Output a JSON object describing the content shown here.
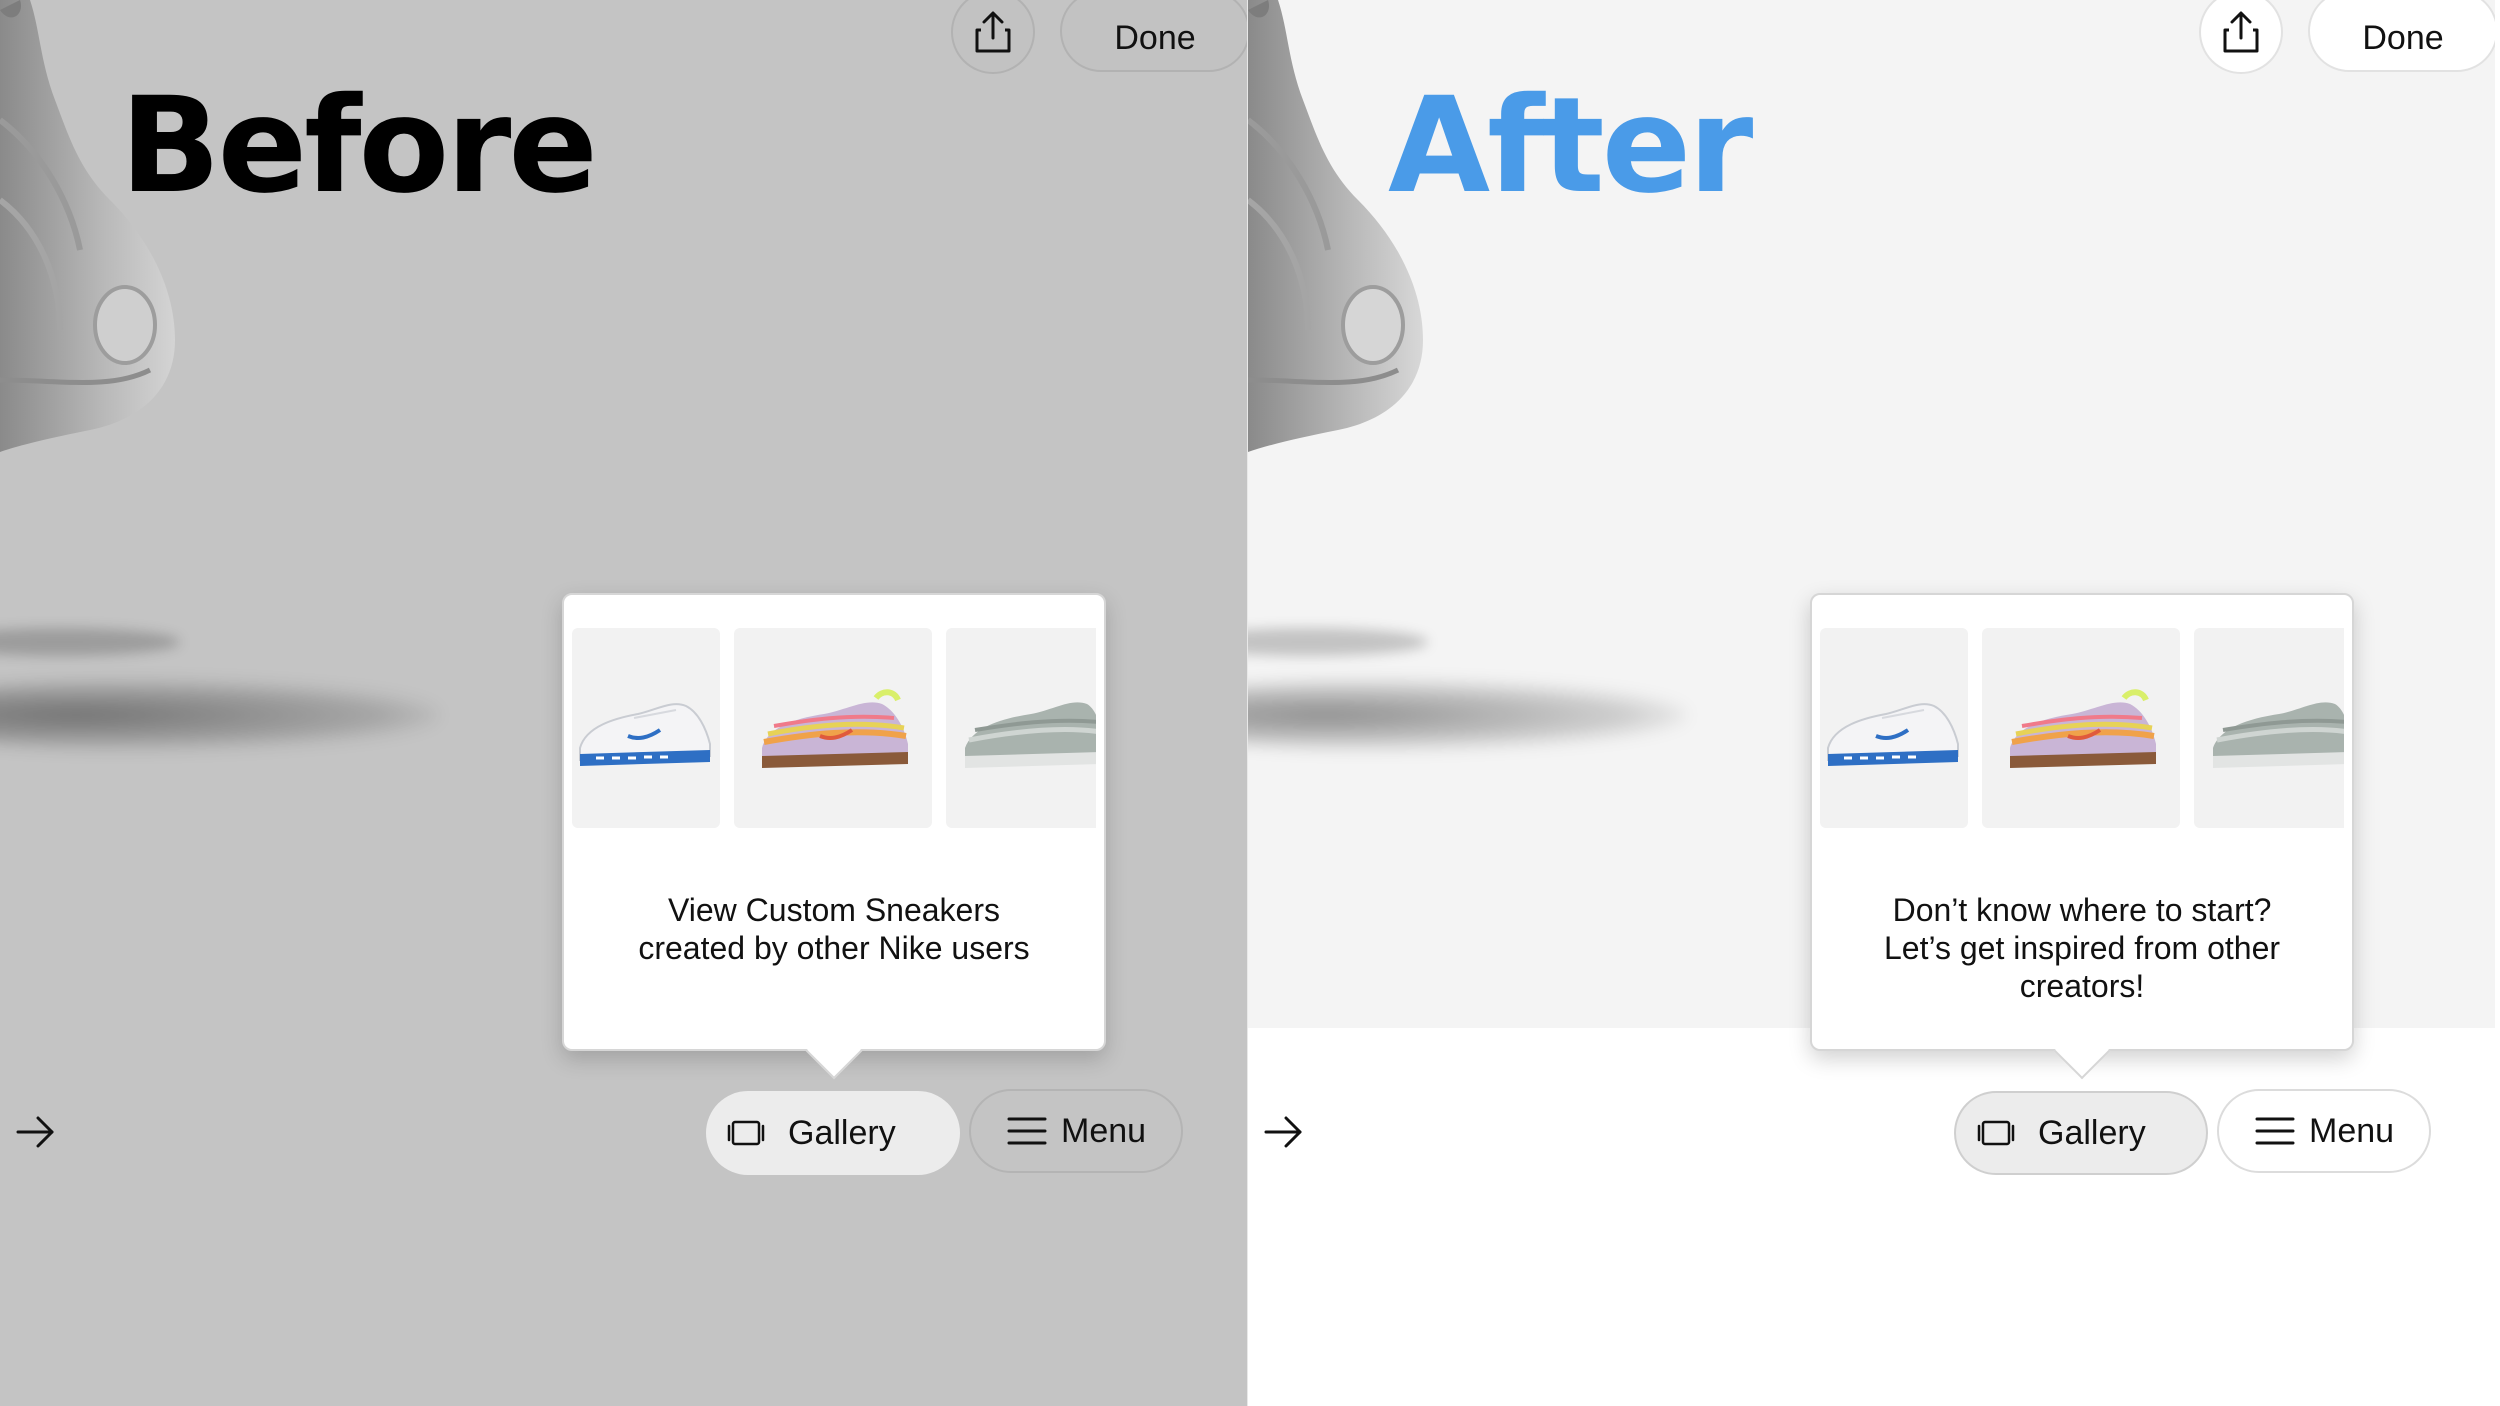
{
  "before": {
    "heading": "Before",
    "done_label": "Done",
    "share_icon": "share-icon",
    "popover": {
      "message_lines": [
        "View Custom Sneakers",
        "created by other Nike users"
      ],
      "thumbnails": [
        "white sneaker with blue accents",
        "multicolor pastel sneaker",
        "silver gray sneaker"
      ]
    },
    "next_icon": "arrow-right-icon",
    "gallery_label": "Gallery",
    "menu_label": "Menu"
  },
  "after": {
    "heading": "After",
    "done_label": "Done",
    "share_icon": "share-icon",
    "popover": {
      "message_lines": [
        "Don’t know where to start?",
        "Let’s get inspired from other",
        "creators!"
      ],
      "thumbnails": [
        "white sneaker with blue accents",
        "multicolor pastel sneaker",
        "silver gray sneaker"
      ]
    },
    "next_icon": "arrow-right-icon",
    "gallery_label": "Gallery",
    "menu_label": "Menu"
  },
  "colors": {
    "before_background": "#c4c4c4",
    "after_background": "#f4f4f4",
    "after_heading": "#4a9be8",
    "before_heading": "#000000"
  }
}
